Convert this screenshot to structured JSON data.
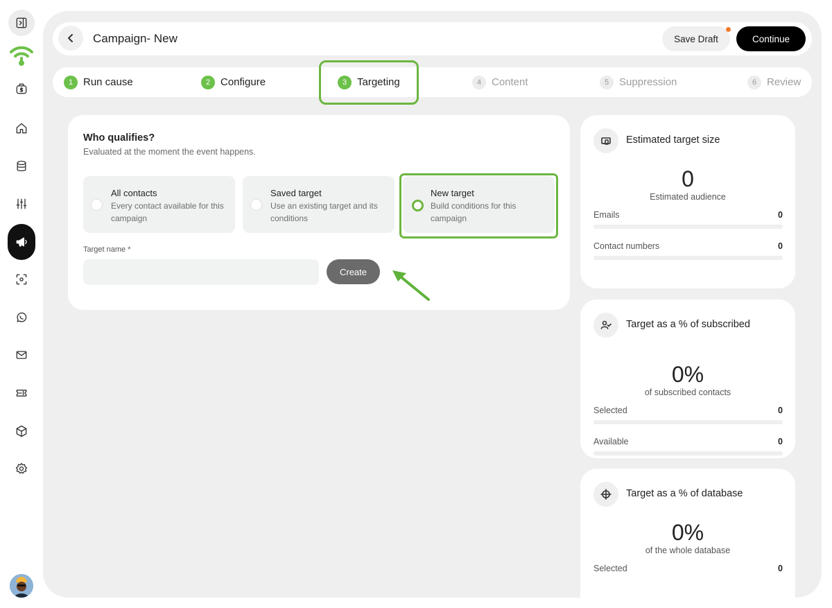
{
  "header": {
    "title": "Campaign- New",
    "save_draft_label": "Save Draft",
    "continue_label": "Continue"
  },
  "steps": [
    {
      "num": "1",
      "label": "Run cause",
      "state": "done"
    },
    {
      "num": "2",
      "label": "Configure",
      "state": "done"
    },
    {
      "num": "3",
      "label": "Targeting",
      "state": "current"
    },
    {
      "num": "4",
      "label": "Content",
      "state": "todo"
    },
    {
      "num": "5",
      "label": "Suppression",
      "state": "todo"
    },
    {
      "num": "6",
      "label": "Review",
      "state": "todo"
    }
  ],
  "qualifies": {
    "title": "Who qualifies?",
    "subtitle": "Evaluated at the moment the event happens.",
    "options": [
      {
        "title": "All contacts",
        "desc": "Every contact available for this campaign",
        "selected": false
      },
      {
        "title": "Saved target",
        "desc": "Use an existing target and its conditions",
        "selected": false
      },
      {
        "title": "New target",
        "desc": "Build conditions for this campaign",
        "selected": true
      }
    ],
    "target_name_label": "Target name *",
    "target_name_value": "",
    "target_name_placeholder": "",
    "create_label": "Create"
  },
  "stats": {
    "size": {
      "title": "Estimated target size",
      "value": "0",
      "caption": "Estimated audience",
      "rows": [
        {
          "label": "Emails",
          "value": "0"
        },
        {
          "label": "Contact numbers",
          "value": "0"
        }
      ]
    },
    "subscribed": {
      "title": "Target as a % of subscribed",
      "value": "0%",
      "caption": "of subscribed contacts",
      "rows": [
        {
          "label": "Selected",
          "value": "0"
        },
        {
          "label": "Available",
          "value": "0"
        }
      ]
    },
    "database": {
      "title": "Target as a % of database",
      "value": "0%",
      "caption": "of the whole database",
      "rows": [
        {
          "label": "Selected",
          "value": "0"
        }
      ]
    }
  },
  "colors": {
    "accent_green": "#6cb63f",
    "step_green": "#6cc14a",
    "draft_dot": "#f07c2c",
    "primary_button": "#000000"
  },
  "icons": {
    "sidebar": [
      "sidebar-toggle-icon",
      "brand-logo-icon",
      "wallet-icon",
      "home-icon",
      "database-icon",
      "sliders-icon",
      "megaphone-icon",
      "scan-icon",
      "whatsapp-icon",
      "mail-icon",
      "ticket-icon",
      "box-icon",
      "gear-icon"
    ],
    "cards": [
      "devices-icon",
      "user-check-icon",
      "crosshair-icon"
    ]
  }
}
